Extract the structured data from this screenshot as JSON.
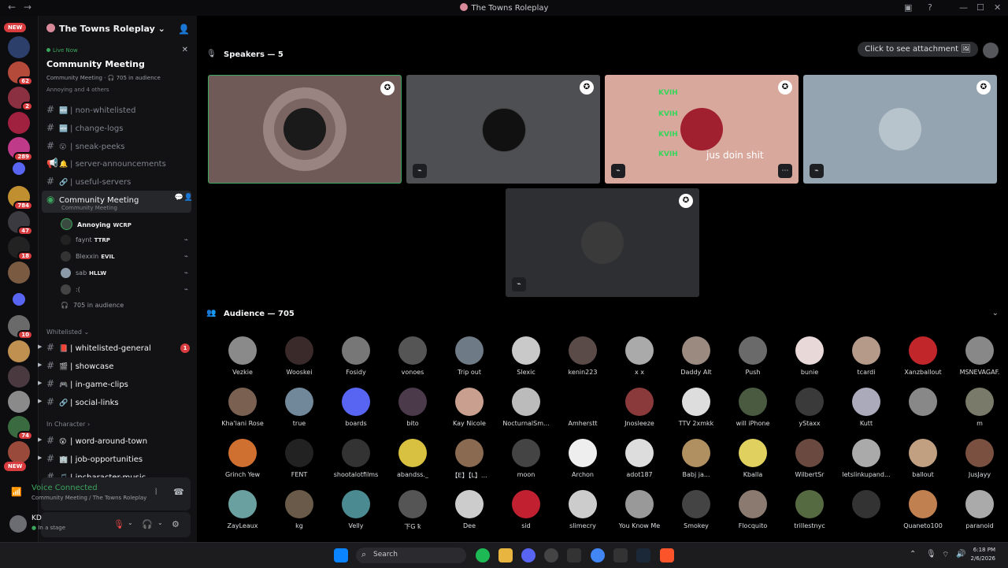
{
  "window": {
    "title": "The Towns Roleplay",
    "back": "←",
    "forward": "→",
    "controls": [
      "▣",
      "?",
      "—",
      "☐",
      "✕"
    ]
  },
  "rail": {
    "new_top": "NEW",
    "new_bottom": "NEW",
    "badges": [
      "62",
      "2",
      "289",
      "784",
      "47",
      "18",
      "10",
      "74"
    ]
  },
  "sidebar": {
    "server_name": "The Towns Roleplay",
    "live_label": "Live Now",
    "event_title": "Community Meeting",
    "event_sub": "Community Meeting · 🎧 705 in audience",
    "event_users": "Annoying and 4 others",
    "channels_top": [
      {
        "emoji": "🆕",
        "name": "non-whitelisted"
      },
      {
        "emoji": "🆕",
        "name": "change-logs"
      },
      {
        "emoji": "😮",
        "name": "sneak-peeks"
      },
      {
        "emoji": "🔔",
        "name": "server-announcements"
      },
      {
        "emoji": "🔗",
        "name": "useful-servers"
      }
    ],
    "stage_channel": "Community Meeting",
    "stage_sub": "Community Meeting",
    "members": [
      {
        "name": "Annoying",
        "tag": "WCRP"
      },
      {
        "name": "faynt",
        "tag": "TTRP"
      },
      {
        "name": "Blexxin",
        "tag": "EVIL"
      },
      {
        "name": "sab",
        "tag": "HLLW"
      },
      {
        "name": ":(",
        "tag": ""
      }
    ],
    "audience_count": "705 in audience",
    "category_whitelisted": "Whitelisted",
    "channels_whitelisted": [
      {
        "emoji": "📕",
        "name": "whitelisted-general",
        "unread": "1"
      },
      {
        "emoji": "🎬",
        "name": "showcase"
      },
      {
        "emoji": "🎮",
        "name": "in-game-clips"
      },
      {
        "emoji": "🔗",
        "name": "social-links"
      }
    ],
    "category_incharacter": "In Character",
    "channels_incharacter": [
      {
        "emoji": "😮",
        "name": "word-around-town"
      },
      {
        "emoji": "🏢",
        "name": "job-opportunities"
      },
      {
        "emoji": "🎵",
        "name": "incharacter-music"
      }
    ]
  },
  "voice": {
    "status": "Voice Connected",
    "location": "Community Meeting / The Towns Roleplay"
  },
  "user": {
    "name": "KD",
    "status": "In a stage"
  },
  "stage": {
    "speakers_label": "Speakers — 5",
    "attachment_label": "Click to see attachment",
    "overlay_text": "jus doin shit",
    "overlay_kvih": "KVIH",
    "audience_label": "Audience — 705",
    "tile_colors": [
      "#705a57",
      "#4e4f52",
      "#d8a89d",
      "#94a5b1",
      "#2e2f33"
    ]
  },
  "audience": [
    "Vezkie",
    "Wooskei",
    "Fosidy",
    "vonoes",
    "Trip out",
    "Slexic",
    "kenin223",
    "x x",
    "Daddy Alt",
    "Push",
    "bunie",
    "tcardi",
    "Xanzballout",
    "MSNEVAGAF.",
    "Kha'lani Rose",
    "true",
    "boards",
    "bito",
    "Kay Nicole",
    "NocturnalSm...",
    "Amherstt",
    "Jnosleeze",
    "TTV 2xmkk",
    "will iPhone",
    "yStaxx",
    "Kutt",
    "",
    "m",
    "Grinch Yew",
    "FENT",
    "shootalotfilms",
    "abandss._",
    "【E】【L】...",
    "moon",
    "Archon",
    "adot187",
    "Babj ja...",
    "Kballa",
    "WilbertSr",
    "letslinkupand...",
    "ballout",
    "JusJayy",
    "ZayLeaux",
    "kg",
    "Velly",
    "下G ꝁ",
    "Dee",
    "sid",
    "slimecry",
    "You Know Me",
    "Smokey",
    "Flocquito",
    "trillestnyc",
    "",
    "Quaneto100",
    "paranoid"
  ],
  "audience_colors": [
    "#8a8a8a",
    "#3a2a2a",
    "#777",
    "#555",
    "#6e7a85",
    "#c9c9c9",
    "#5a4a48",
    "#aaa",
    "#9a8a80",
    "#6a6a6a",
    "#e8d8d8",
    "#b59a8a",
    "#c0262a",
    "#888",
    "#7a6050",
    "#70889a",
    "#5865f2",
    "#4a3a4a",
    "#c9a090",
    "#bbb",
    "#000",
    "#8a3a3a",
    "#ddd",
    "#4a5a40",
    "#3a3a3a",
    "#aab",
    "#888",
    "#7a7a6a",
    "#d07030",
    "#222",
    "#333",
    "#d8c040",
    "#8a6a50",
    "#444",
    "#eee",
    "#ddd",
    "#b09060",
    "#e0d060",
    "#6a4a40",
    "#aaa",
    "#c0a080",
    "#7a5040",
    "#6aa0a0",
    "#6a5a4a",
    "#4a8a90",
    "#555",
    "#ccc",
    "#c02030",
    "#ccc",
    "#999",
    "#444",
    "#8a7a70",
    "#556a40",
    "#333",
    "#c08050",
    "#aaa"
  ],
  "taskbar": {
    "search": "Search",
    "time": "6:18 PM",
    "date": "2/6/2026"
  }
}
